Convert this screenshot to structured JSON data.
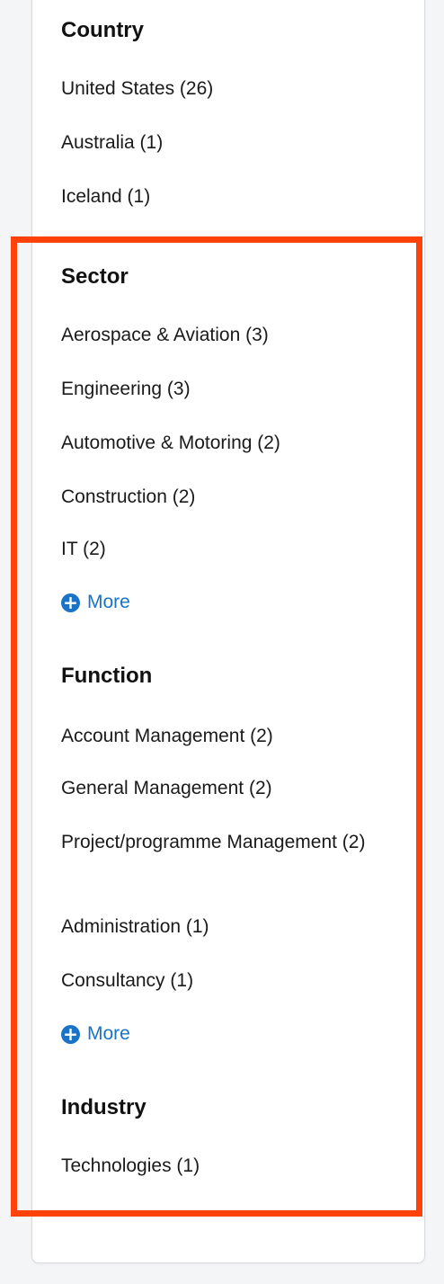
{
  "country": {
    "heading": "Country",
    "items": [
      "United States (26)",
      "Australia (1)",
      "Iceland (1)"
    ]
  },
  "sector": {
    "heading": "Sector",
    "items": [
      "Aerospace & Aviation (3)",
      "Engineering (3)",
      "Automotive & Motoring (2)",
      "Construction (2)",
      "IT (2)"
    ],
    "more": "More"
  },
  "function": {
    "heading": "Function",
    "items": [
      "Account Management (2)",
      "General Management (2)",
      "Project/programme Management (2)",
      "Administration (1)",
      "Consultancy (1)"
    ],
    "more": "More"
  },
  "industry": {
    "heading": "Industry",
    "items": [
      "Technologies (1)"
    ]
  },
  "colors": {
    "highlight": "#ff4209",
    "link": "#1a73c6"
  },
  "icons": {
    "more": "plus-circle-icon"
  }
}
